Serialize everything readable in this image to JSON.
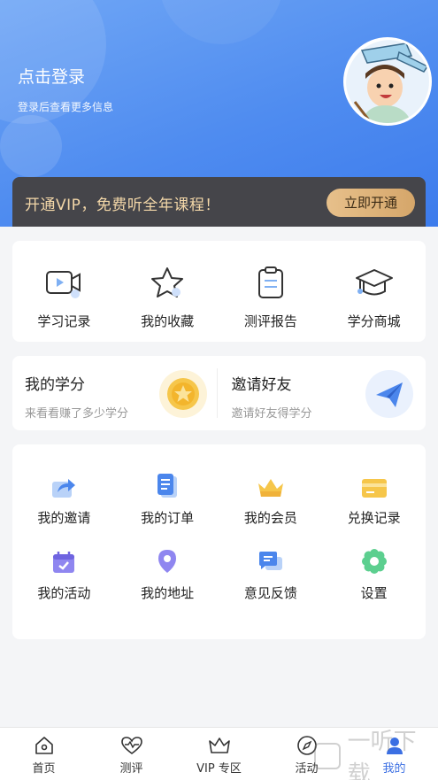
{
  "header": {
    "login_title": "点击登录",
    "login_subtitle": "登录后查看更多信息"
  },
  "vip_banner": {
    "text": "开通VIP，免费听全年课程！",
    "button": "立即开通"
  },
  "quick_links": [
    {
      "label": "学习记录",
      "icon": "video-icon"
    },
    {
      "label": "我的收藏",
      "icon": "star-icon"
    },
    {
      "label": "测评报告",
      "icon": "clipboard-icon"
    },
    {
      "label": "学分商城",
      "icon": "graduation-cap-icon"
    }
  ],
  "credits": {
    "title": "我的学分",
    "subtitle": "来看看赚了多少学分"
  },
  "invite": {
    "title": "邀请好友",
    "subtitle": "邀请好友得学分"
  },
  "services_row1": [
    {
      "label": "我的邀请",
      "icon": "share-icon"
    },
    {
      "label": "我的订单",
      "icon": "document-icon"
    },
    {
      "label": "我的会员",
      "icon": "crown-icon"
    },
    {
      "label": "兑换记录",
      "icon": "card-icon"
    }
  ],
  "services_row2": [
    {
      "label": "我的活动",
      "icon": "calendar-icon"
    },
    {
      "label": "我的地址",
      "icon": "location-icon"
    },
    {
      "label": "意见反馈",
      "icon": "chat-icon"
    },
    {
      "label": "设置",
      "icon": "flower-gear-icon"
    }
  ],
  "tabs": [
    {
      "label": "首页",
      "icon": "home-icon"
    },
    {
      "label": "测评",
      "icon": "heart-pulse-icon"
    },
    {
      "label": "VIP 专区",
      "icon": "crown-icon"
    },
    {
      "label": "活动",
      "icon": "compass-icon"
    },
    {
      "label": "我的",
      "icon": "user-icon",
      "active": true
    }
  ],
  "watermark": "一听下载",
  "colors": {
    "header_blue": "#4f8cf0",
    "vip_dark": "#45454a",
    "vip_gold": "#e7c08b",
    "accent_blue": "#3b6fe3"
  }
}
